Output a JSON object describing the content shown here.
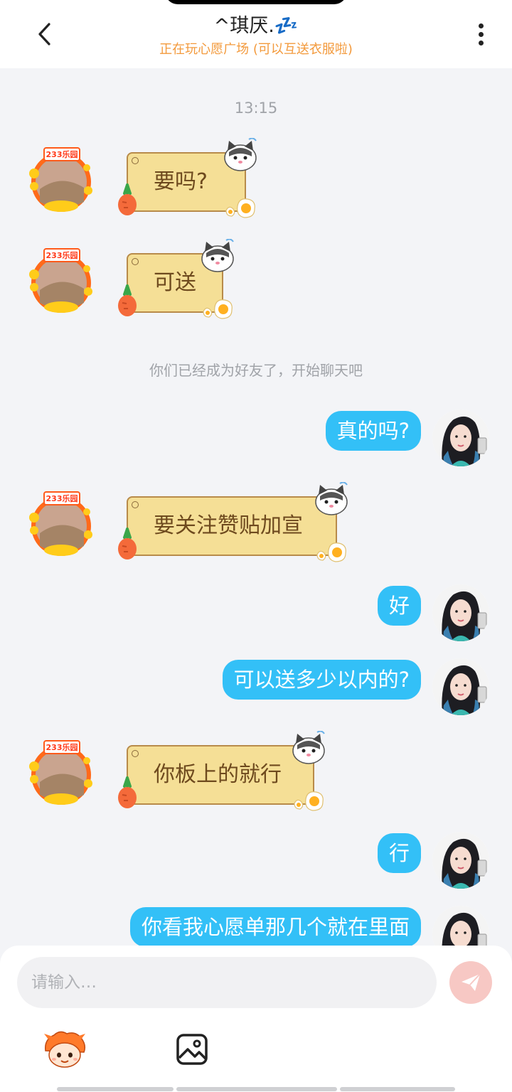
{
  "header": {
    "title": "^琪厌.💤",
    "subtitle": "正在玩心愿广场 (可以互送衣服啦)",
    "back_icon": "chevron-left-icon",
    "more_icon": "more-vertical-icon"
  },
  "chat": {
    "timestamp": "13:15",
    "system_notice": "你们已经成为好友了，开始聊天吧",
    "messages": [
      {
        "side": "left",
        "text": "要吗?"
      },
      {
        "side": "left",
        "text": "可送"
      },
      {
        "side": "right",
        "text": "真的吗?"
      },
      {
        "side": "left",
        "text": "要关注赞贴加宣"
      },
      {
        "side": "right",
        "text": "好"
      },
      {
        "side": "right",
        "text": "可以送多少以内的?"
      },
      {
        "side": "left",
        "text": "你板上的就行"
      },
      {
        "side": "right",
        "text": "行"
      },
      {
        "side": "right",
        "text": "你看我心愿单那几个就在里面"
      }
    ],
    "left_avatar_badge": "233乐园"
  },
  "composer": {
    "placeholder": "请输入…",
    "send_icon": "send-icon",
    "emoji_icon": "emoji-mascot-icon",
    "image_icon": "image-icon"
  },
  "colors": {
    "accent_orange": "#f39a3c",
    "bubble_blue": "#33c0f7",
    "note_yellow": "#f5df96"
  }
}
